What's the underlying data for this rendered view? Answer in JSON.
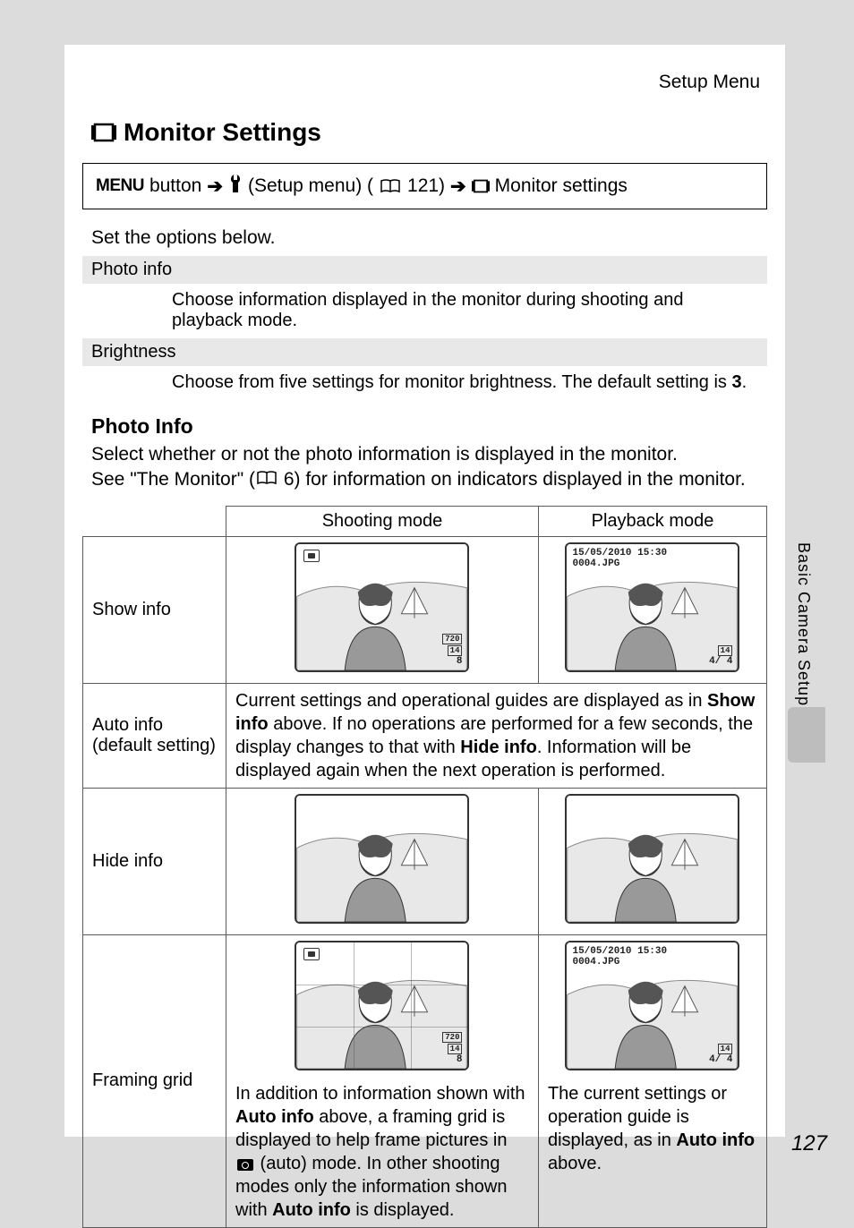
{
  "section_header": "Setup Menu",
  "title": "Monitor Settings",
  "breadcrumb": {
    "menu_button": "MENU",
    "button_word": "button",
    "setup_menu": "(Setup menu) (",
    "page_ref_121": "121)",
    "monitor_settings": "Monitor settings"
  },
  "intro": "Set the options below.",
  "options": [
    {
      "name": "Photo info",
      "desc": "Choose information displayed in the monitor during shooting and playback mode."
    },
    {
      "name": "Brightness",
      "desc_pre": "Choose from five settings for monitor brightness. The default setting is ",
      "desc_bold": "3",
      "desc_post": "."
    }
  ],
  "subhead": "Photo Info",
  "subtext_line1": "Select whether or not the photo information is displayed in the monitor.",
  "subtext_line2_pre": "See \"The Monitor\" (",
  "subtext_line2_ref": "6) for information on indicators displayed in the monitor.",
  "table": {
    "col_shooting": "Shooting mode",
    "col_playback": "Playback mode",
    "rows": {
      "show_info": "Show info",
      "auto_info_line1": "Auto info",
      "auto_info_line2": "(default setting)",
      "hide_info": "Hide info",
      "framing_grid": "Framing grid"
    },
    "auto_info_text_parts": [
      "Current settings and operational guides are displayed as in ",
      "Show info",
      " above. If no operations are performed for a few seconds, the display changes to that with ",
      "Hide info",
      ". Information will be displayed again when the next operation is performed."
    ],
    "framing_shoot_parts": [
      "In addition to information shown with ",
      "Auto info",
      " above, a framing grid is displayed to help frame pictures in ",
      " (auto) mode. In other shooting modes only the information shown with ",
      "Auto info",
      " is displayed."
    ],
    "framing_play_parts": [
      "The current settings or operation guide is displayed, as in ",
      "Auto info",
      " above."
    ]
  },
  "overlay": {
    "date": "15/05/2010 15:30",
    "file": "0004.JPG",
    "counter": "4/   4",
    "res_720": "720",
    "res_14": "14",
    "shots": "8"
  },
  "side_tab": "Basic Camera Setup",
  "page_number": "127"
}
